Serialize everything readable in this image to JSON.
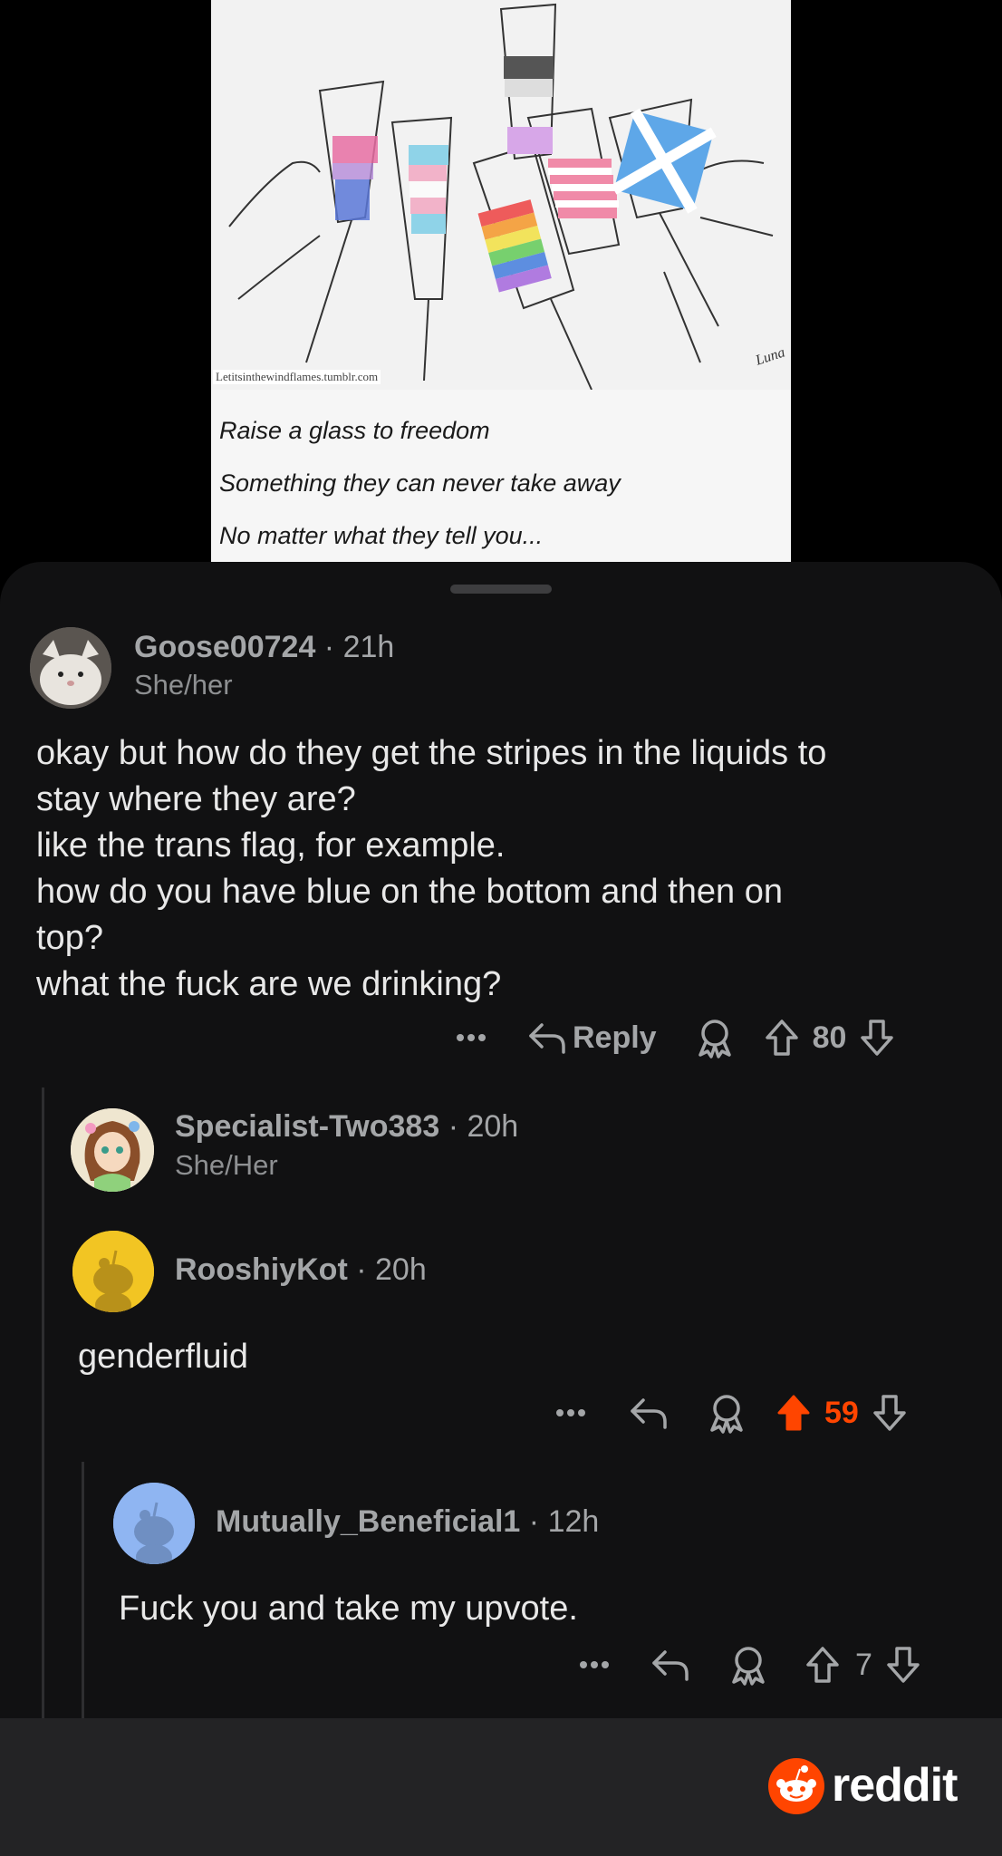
{
  "post_image": {
    "watermark": "Letitsinthewindflames.tumblr.com",
    "captions": [
      "Raise a glass to freedom",
      "Something they can never take away",
      "No matter what they tell you..."
    ]
  },
  "comments": [
    {
      "username": "Goose00724",
      "time": "21h",
      "flair": "She/her",
      "body": [
        "okay but how do they get the stripes in the liquids to",
        "stay where they are?",
        "like the trans flag, for example.",
        "how do you have blue on the bottom and then on",
        "top?",
        "what the fuck are we drinking?"
      ],
      "reply_label": "Reply",
      "score": "80",
      "upvoted": false
    },
    {
      "username": "Specialist-Two383",
      "time": "20h",
      "flair": "She/Her"
    },
    {
      "username": "RooshiyKot",
      "time": "20h",
      "body": [
        "genderfluid"
      ],
      "score": "59",
      "upvoted": true
    },
    {
      "username": "Mutually_Beneficial1",
      "time": "12h",
      "body": [
        "Fuck you and take my upvote."
      ],
      "score": "7",
      "upvoted": false
    }
  ],
  "footer": {
    "brand": "reddit"
  },
  "colors": {
    "upvote": "#ff4500",
    "background": "#111112",
    "footer": "#232325"
  },
  "icons": [
    "more-icon",
    "reply-icon",
    "award-icon",
    "upvote-icon",
    "downvote-icon",
    "reddit-logo-icon"
  ]
}
